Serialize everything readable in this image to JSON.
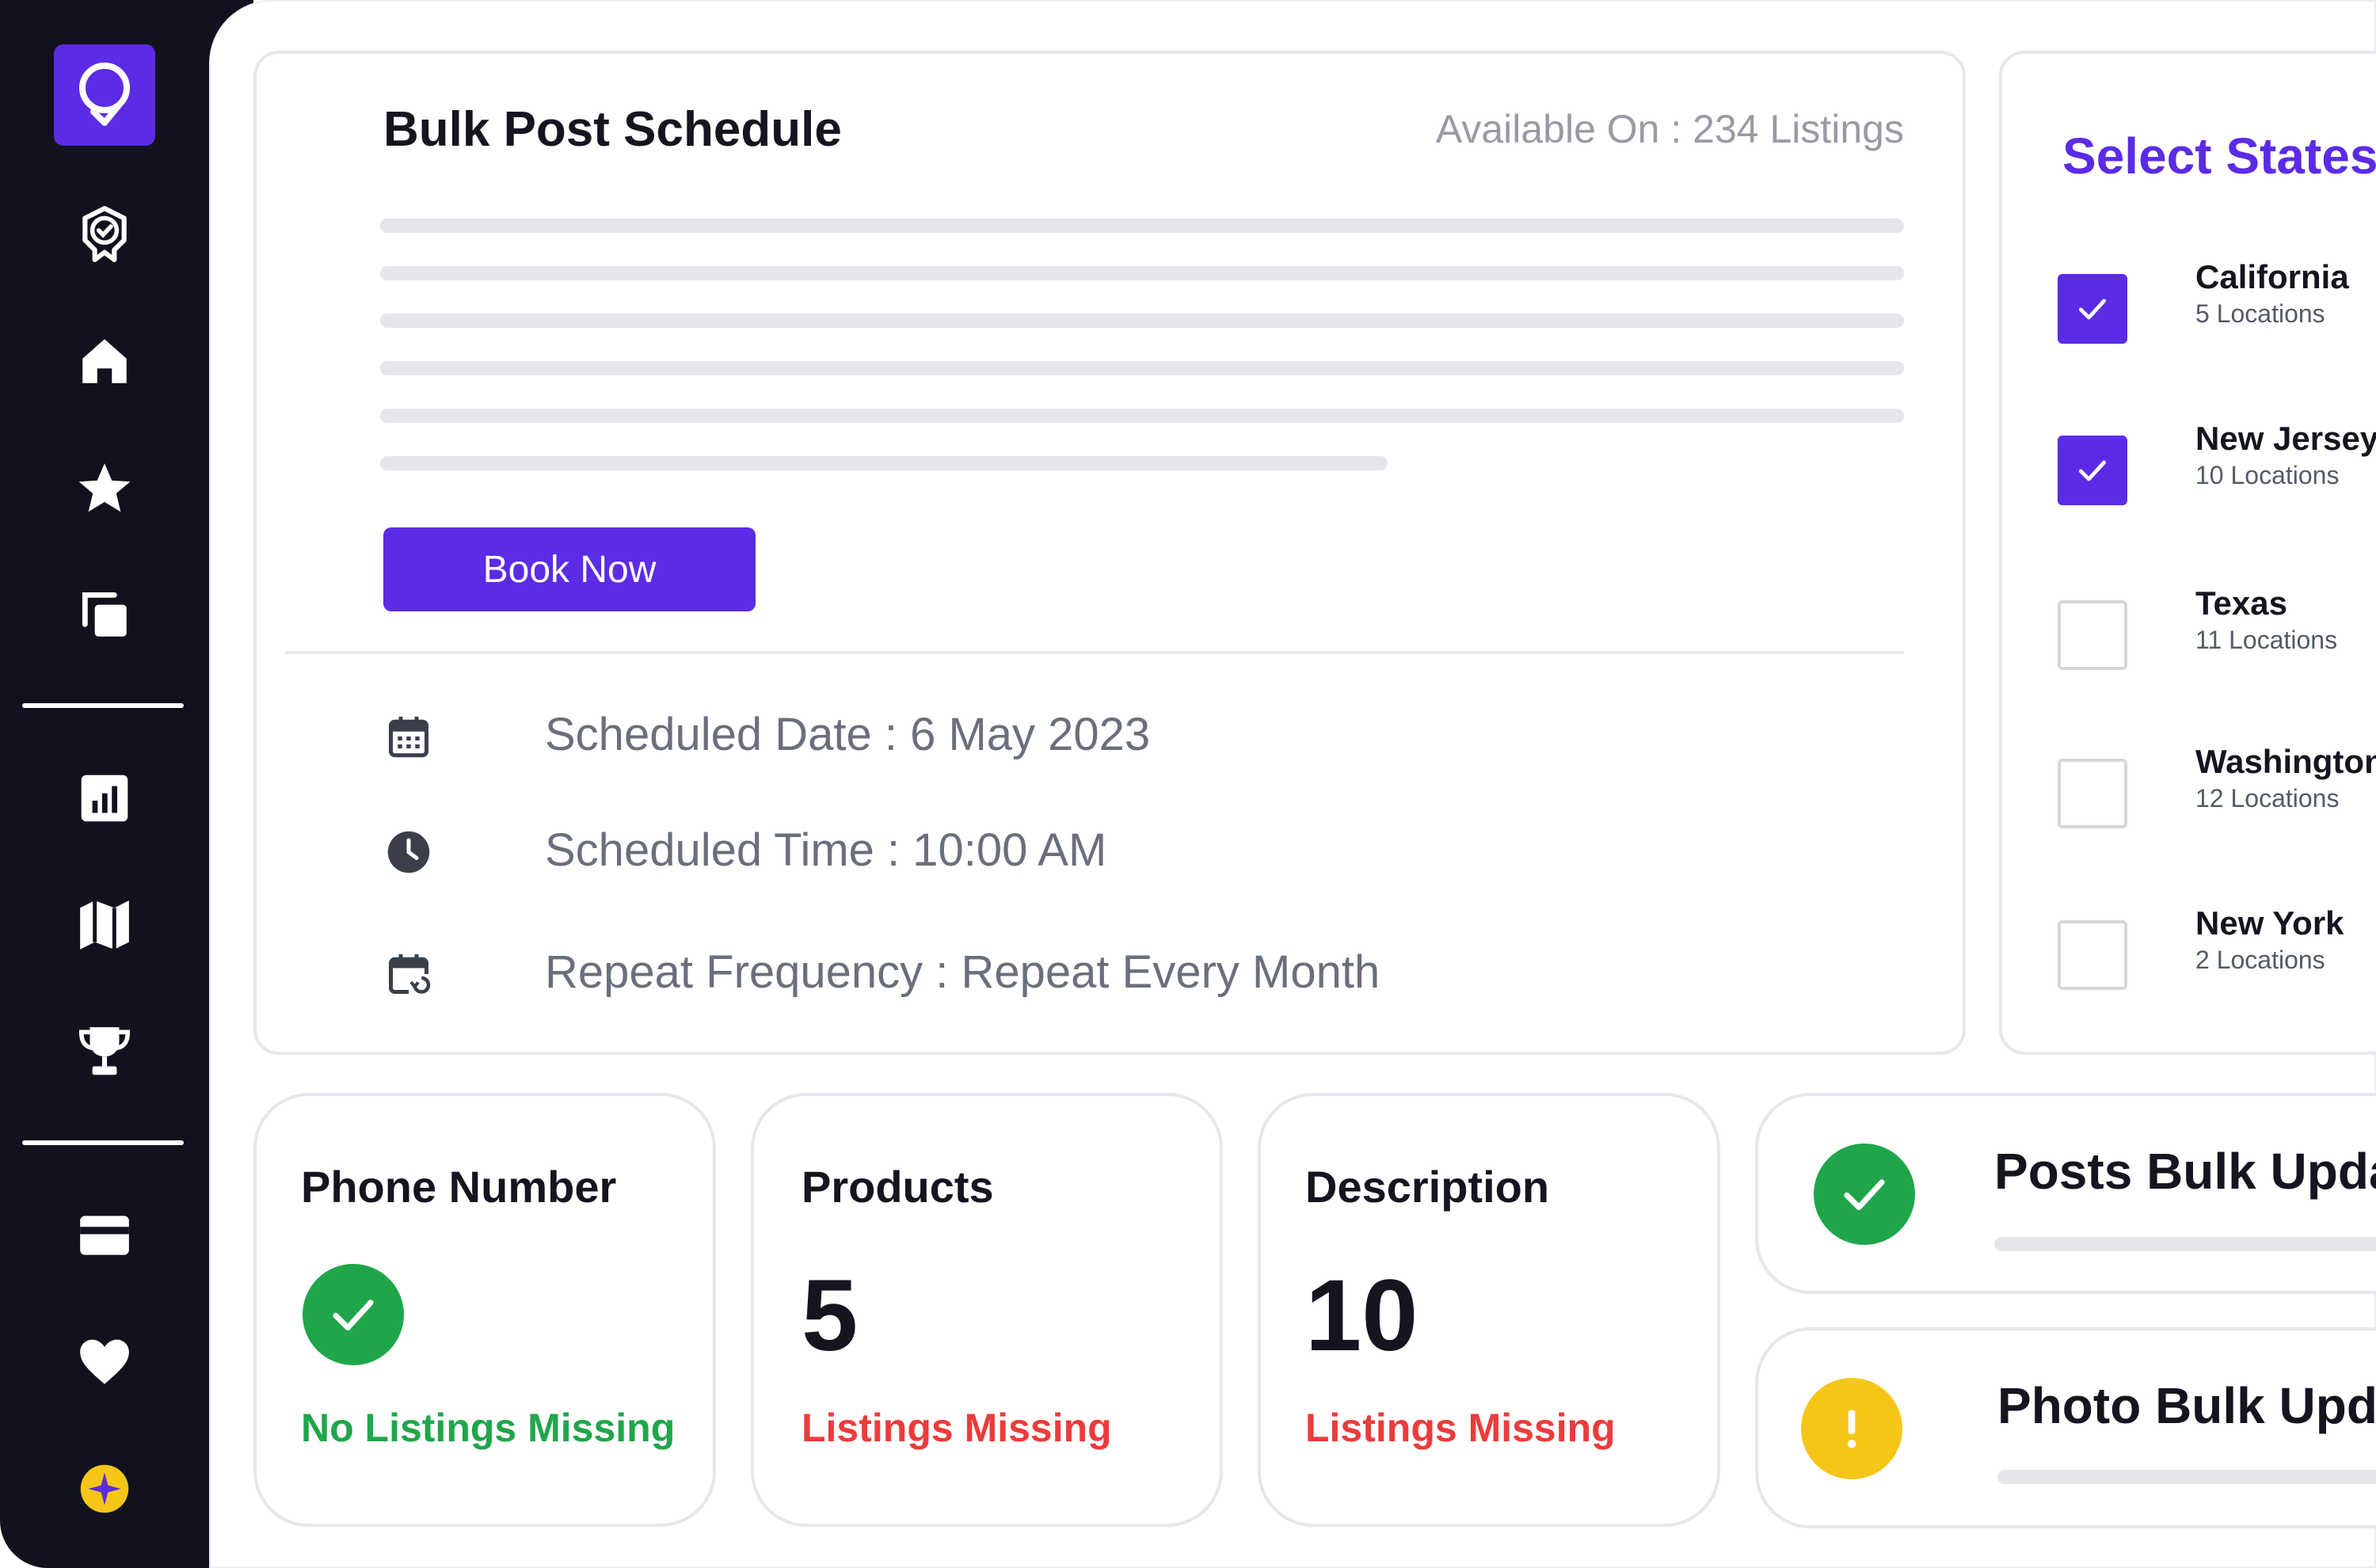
{
  "sidebar": {
    "logo": "pin-logo-icon",
    "items": [
      {
        "icon": "badge-check-icon"
      },
      {
        "icon": "home-icon"
      },
      {
        "icon": "star-icon"
      },
      {
        "icon": "copy-icon"
      },
      {
        "icon": "bar-chart-icon"
      },
      {
        "icon": "map-icon"
      },
      {
        "icon": "trophy-icon"
      },
      {
        "icon": "credit-card-icon"
      },
      {
        "icon": "heart-icon"
      },
      {
        "icon": "sparkle-icon"
      }
    ]
  },
  "schedule": {
    "title": "Bulk Post Schedule",
    "available": "Available On : 234 Listings",
    "book_label": "Book Now",
    "date": "Scheduled Date : 6 May 2023",
    "time": "Scheduled Time : 10:00 AM",
    "repeat": "Repeat Frequency : Repeat Every Month"
  },
  "states": {
    "title": "Select States",
    "items": [
      {
        "name": "California",
        "sub": "5 Locations",
        "checked": true
      },
      {
        "name": "New Jersey",
        "sub": "10 Locations",
        "checked": true
      },
      {
        "name": "Texas",
        "sub": "11 Locations",
        "checked": false
      },
      {
        "name": "Washington",
        "sub": "12 Locations",
        "checked": false
      },
      {
        "name": "New York",
        "sub": "2 Locations",
        "checked": false
      }
    ]
  },
  "stats": {
    "phone": {
      "title": "Phone Number",
      "note": "No Listings Missing"
    },
    "products": {
      "title": "Products",
      "value": "5",
      "note": "Listings Missing"
    },
    "description": {
      "title": "Description",
      "value": "10",
      "note": "Listings Missing"
    }
  },
  "bulk": {
    "posts": "Posts Bulk Update",
    "photo": "Photo Bulk Update"
  },
  "colors": {
    "accent": "#5b2be6",
    "sidebar": "#12121e",
    "success": "#1fa64a",
    "danger": "#ec3b3b",
    "warning": "#f5c518"
  }
}
